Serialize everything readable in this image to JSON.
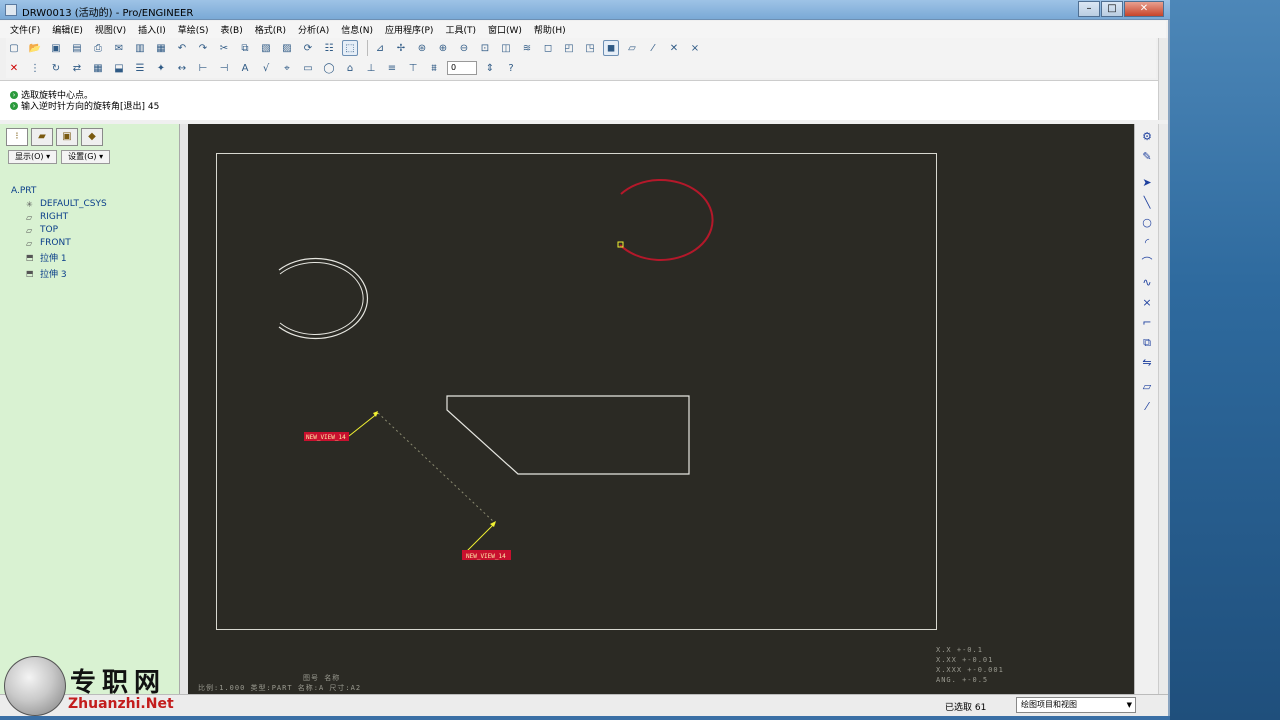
{
  "window": {
    "title": "DRW0013 (活动的) - Pro/ENGINEER",
    "minimize": "–",
    "maximize": "□",
    "close": "✕"
  },
  "menu": [
    "文件(F)",
    "编辑(E)",
    "视图(V)",
    "插入(I)",
    "草绘(S)",
    "表(B)",
    "格式(R)",
    "分析(A)",
    "信息(N)",
    "应用程序(P)",
    "工具(T)",
    "窗口(W)",
    "帮助(H)"
  ],
  "toolbar": {
    "spin_value": "0"
  },
  "messages": [
    "选取旋转中心点。",
    "输入逆时针方向的旋转角[退出]  45"
  ],
  "left_panel": {
    "display_button": "显示(O) ▾",
    "settings_button": "设置(G) ▾",
    "tree_root": "A.PRT",
    "tree_items": [
      {
        "label": "DEFAULT_CSYS",
        "icon": "csys-icon"
      },
      {
        "label": "RIGHT",
        "icon": "datum-plane-icon"
      },
      {
        "label": "TOP",
        "icon": "datum-plane-icon"
      },
      {
        "label": "FRONT",
        "icon": "datum-plane-icon"
      },
      {
        "label": "拉伸 1",
        "icon": "extrude-icon"
      },
      {
        "label": "拉伸 3",
        "icon": "extrude-icon"
      }
    ]
  },
  "drawing": {
    "view_label_1": "NEW_VIEW_14",
    "view_label_2": "NEW_VIEW_14",
    "bottom_info_1": "比例:1.000   类型:PART   名称:A   尺寸:A2",
    "bottom_info_2": "图号 名称",
    "tolerance": [
      "X.X    +-0.1",
      "X.XX   +-0.01",
      "X.XXX  +-0.001",
      "ANG.   +-0.5"
    ],
    "colors": {
      "background": "#2b2a24",
      "geometry": "#e6e6e0",
      "selected": "#b4182a",
      "leader": "#f2f232",
      "label_bg": "#c8102e"
    }
  },
  "status": {
    "selected_count": "已选取 61",
    "filter": "绘图项目和视图"
  },
  "watermark": {
    "cn": "专职网",
    "en": "Zhuanzhi.Net"
  }
}
